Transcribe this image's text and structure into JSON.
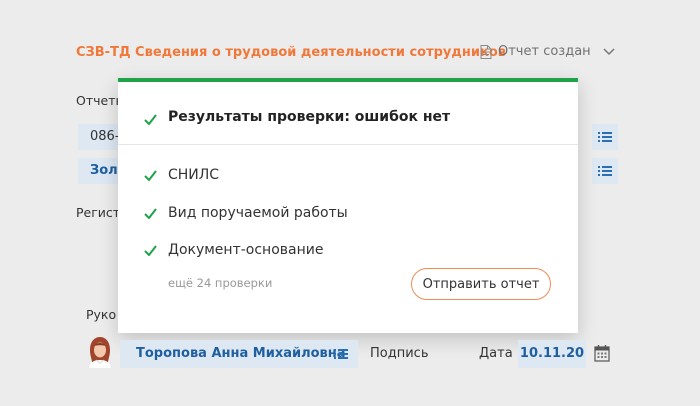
{
  "header": {
    "title": "СЗВ-ТД Сведения о трудовой деятельности сотрудников",
    "status": "Отчет создан"
  },
  "background": {
    "reporting_label": "Отчетн",
    "field1": "086-",
    "field2": "Золо",
    "reg_label": "Регист",
    "head_label": "Руко"
  },
  "popup": {
    "title": "Результаты проверки: ошибок нет",
    "checks": [
      "СНИЛС",
      "Вид поручаемой работы",
      "Документ-основание"
    ],
    "more": "ещё 24 проверки",
    "send_button": "Отправить отчет"
  },
  "footer": {
    "signer": "Торопова Анна Михайловна",
    "signature_label": "Подпись",
    "date_label": "Дата",
    "date": "10.11.20"
  },
  "colors": {
    "accent": "#f07838",
    "success": "#1fa34a",
    "field_bg": "#dde8f3",
    "link": "#1f5fa0"
  }
}
